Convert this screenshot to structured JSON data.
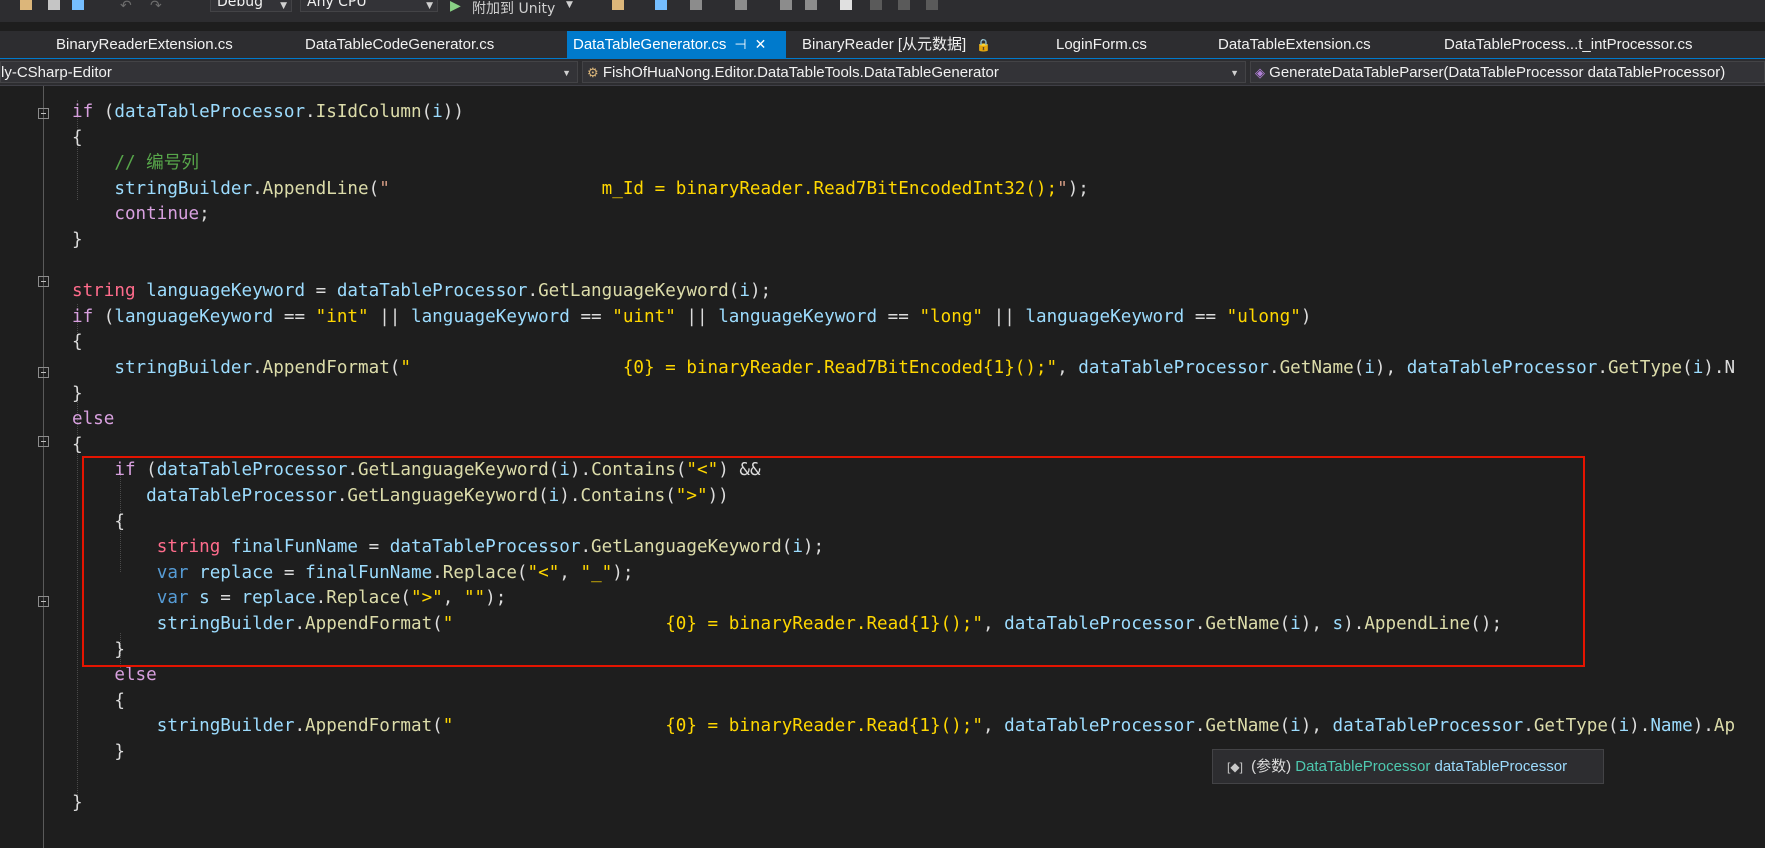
{
  "toolbar": {
    "configuration": "Debug",
    "platform": "Any CPU",
    "attach_label": "附加到 Unity"
  },
  "tabs": [
    {
      "label": "BinaryReaderExtension.cs"
    },
    {
      "label": "DataTableCodeGenerator.cs"
    },
    {
      "label": "DataTableGenerator.cs",
      "active": true
    },
    {
      "label": "BinaryReader [从元数据]"
    },
    {
      "label": "LoginForm.cs"
    },
    {
      "label": "DataTableExtension.cs"
    },
    {
      "label": "DataTableProcess...t_intProcessor.cs"
    }
  ],
  "navbar": {
    "project": "ly-CSharp-Editor",
    "class": "FishOfHuaNong.Editor.DataTableTools.DataTableGenerator",
    "member": "GenerateDataTableParser(DataTableProcessor dataTableProcessor)"
  },
  "code_lines": [
    {
      "tokens": [
        [
          "k-ctl",
          "if"
        ],
        [
          "k-op",
          " ("
        ],
        [
          "k-id",
          "dataTableProcessor"
        ],
        [
          "k-op",
          "."
        ],
        [
          "k-fn",
          "IsIdColumn"
        ],
        [
          "k-op",
          "("
        ],
        [
          "k-id",
          "i"
        ],
        [
          "k-op",
          "))"
        ]
      ]
    },
    {
      "tokens": [
        [
          "k-op",
          "{"
        ]
      ]
    },
    {
      "tokens": [
        [
          "k-cm",
          "    // 编号列"
        ]
      ]
    },
    {
      "tokens": [
        [
          "k-id",
          "    stringBuilder"
        ],
        [
          "k-op",
          "."
        ],
        [
          "k-fn",
          "AppendLine"
        ],
        [
          "k-op",
          "("
        ],
        [
          "k-str",
          "\""
        ],
        [
          "k-str2",
          "                    m_Id = binaryReader.Read7BitEncodedInt32();"
        ],
        [
          "k-str",
          "\""
        ],
        [
          "k-op",
          ");"
        ]
      ]
    },
    {
      "tokens": [
        [
          "k-ctl",
          "    continue"
        ],
        [
          "k-op",
          ";"
        ]
      ]
    },
    {
      "tokens": [
        [
          "k-op",
          "}"
        ]
      ]
    },
    {
      "tokens": [
        [
          "k-op",
          ""
        ]
      ]
    },
    {
      "tokens": [
        [
          "k-type",
          "string"
        ],
        [
          "k-op",
          " "
        ],
        [
          "k-id",
          "languageKeyword"
        ],
        [
          "k-op",
          " = "
        ],
        [
          "k-id",
          "dataTableProcessor"
        ],
        [
          "k-op",
          "."
        ],
        [
          "k-fn",
          "GetLanguageKeyword"
        ],
        [
          "k-op",
          "("
        ],
        [
          "k-id",
          "i"
        ],
        [
          "k-op",
          ");"
        ]
      ]
    },
    {
      "tokens": [
        [
          "k-ctl",
          "if"
        ],
        [
          "k-op",
          " ("
        ],
        [
          "k-id",
          "languageKeyword"
        ],
        [
          "k-op",
          " == "
        ],
        [
          "k-str2",
          "\"int\""
        ],
        [
          "k-op",
          " || "
        ],
        [
          "k-id",
          "languageKeyword"
        ],
        [
          "k-op",
          " == "
        ],
        [
          "k-str2",
          "\"uint\""
        ],
        [
          "k-op",
          " || "
        ],
        [
          "k-id",
          "languageKeyword"
        ],
        [
          "k-op",
          " == "
        ],
        [
          "k-str2",
          "\"long\""
        ],
        [
          "k-op",
          " || "
        ],
        [
          "k-id",
          "languageKeyword"
        ],
        [
          "k-op",
          " == "
        ],
        [
          "k-str2",
          "\"ulong\""
        ],
        [
          "k-op",
          ")"
        ]
      ]
    },
    {
      "tokens": [
        [
          "k-op",
          "{"
        ]
      ]
    },
    {
      "tokens": [
        [
          "k-id",
          "    stringBuilder"
        ],
        [
          "k-op",
          "."
        ],
        [
          "k-fn",
          "AppendFormat"
        ],
        [
          "k-op",
          "("
        ],
        [
          "k-str2",
          "\"                    {0} = binaryReader.Read7BitEncoded{1}();\""
        ],
        [
          "k-op",
          ", "
        ],
        [
          "k-id",
          "dataTableProcessor"
        ],
        [
          "k-op",
          "."
        ],
        [
          "k-fn",
          "GetName"
        ],
        [
          "k-op",
          "("
        ],
        [
          "k-id",
          "i"
        ],
        [
          "k-op",
          "), "
        ],
        [
          "k-id",
          "dataTableProcessor"
        ],
        [
          "k-op",
          "."
        ],
        [
          "k-fn",
          "GetType"
        ],
        [
          "k-op",
          "("
        ],
        [
          "k-id",
          "i"
        ],
        [
          "k-op",
          ").N"
        ]
      ]
    },
    {
      "tokens": [
        [
          "k-op",
          "}"
        ]
      ]
    },
    {
      "tokens": [
        [
          "k-ctl",
          "else"
        ]
      ]
    },
    {
      "tokens": [
        [
          "k-op",
          "{"
        ]
      ]
    },
    {
      "tokens": [
        [
          "k-ctl",
          "    if"
        ],
        [
          "k-op",
          " ("
        ],
        [
          "k-id",
          "dataTableProcessor"
        ],
        [
          "k-op",
          "."
        ],
        [
          "k-fn",
          "GetLanguageKeyword"
        ],
        [
          "k-op",
          "("
        ],
        [
          "k-id",
          "i"
        ],
        [
          "k-op",
          ")."
        ],
        [
          "k-fn",
          "Contains"
        ],
        [
          "k-op",
          "("
        ],
        [
          "k-str2",
          "\"<\""
        ],
        [
          "k-op",
          ") &&"
        ]
      ]
    },
    {
      "tokens": [
        [
          "k-id",
          "       dataTableProcessor"
        ],
        [
          "k-op",
          "."
        ],
        [
          "k-fn",
          "GetLanguageKeyword"
        ],
        [
          "k-op",
          "("
        ],
        [
          "k-id",
          "i"
        ],
        [
          "k-op",
          ")."
        ],
        [
          "k-fn",
          "Contains"
        ],
        [
          "k-op",
          "("
        ],
        [
          "k-str2",
          "\">\""
        ],
        [
          "k-op",
          "))"
        ]
      ]
    },
    {
      "tokens": [
        [
          "k-op",
          "    {"
        ]
      ]
    },
    {
      "tokens": [
        [
          "k-type",
          "        string"
        ],
        [
          "k-op",
          " "
        ],
        [
          "k-id",
          "finalFunName"
        ],
        [
          "k-op",
          " = "
        ],
        [
          "k-id",
          "dataTableProcessor"
        ],
        [
          "k-op",
          "."
        ],
        [
          "k-fn",
          "GetLanguageKeyword"
        ],
        [
          "k-op",
          "("
        ],
        [
          "k-id",
          "i"
        ],
        [
          "k-op",
          ");"
        ]
      ]
    },
    {
      "tokens": [
        [
          "k-kw",
          "        var"
        ],
        [
          "k-op",
          " "
        ],
        [
          "k-id",
          "replace"
        ],
        [
          "k-op",
          " = "
        ],
        [
          "k-id",
          "finalFunName"
        ],
        [
          "k-op",
          "."
        ],
        [
          "k-fn",
          "Replace"
        ],
        [
          "k-op",
          "("
        ],
        [
          "k-str2",
          "\"<\""
        ],
        [
          "k-op",
          ", "
        ],
        [
          "k-str2",
          "\"_\""
        ],
        [
          "k-op",
          ");"
        ]
      ]
    },
    {
      "tokens": [
        [
          "k-kw",
          "        var"
        ],
        [
          "k-op",
          " "
        ],
        [
          "k-id",
          "s"
        ],
        [
          "k-op",
          " = "
        ],
        [
          "k-id",
          "replace"
        ],
        [
          "k-op",
          "."
        ],
        [
          "k-fn",
          "Replace"
        ],
        [
          "k-op",
          "("
        ],
        [
          "k-str2",
          "\">\""
        ],
        [
          "k-op",
          ", "
        ],
        [
          "k-str2",
          "\"\""
        ],
        [
          "k-op",
          ");"
        ]
      ]
    },
    {
      "tokens": [
        [
          "k-id",
          "        stringBuilder"
        ],
        [
          "k-op",
          "."
        ],
        [
          "k-fn",
          "AppendFormat"
        ],
        [
          "k-op",
          "("
        ],
        [
          "k-str2",
          "\"                    {0} = binaryReader.Read{1}();\""
        ],
        [
          "k-op",
          ", "
        ],
        [
          "k-id",
          "dataTableProcessor"
        ],
        [
          "k-op",
          "."
        ],
        [
          "k-fn",
          "GetName"
        ],
        [
          "k-op",
          "("
        ],
        [
          "k-id",
          "i"
        ],
        [
          "k-op",
          "), "
        ],
        [
          "k-id",
          "s"
        ],
        [
          "k-op",
          ")."
        ],
        [
          "k-fn",
          "AppendLine"
        ],
        [
          "k-op",
          "();"
        ]
      ]
    },
    {
      "tokens": [
        [
          "k-op",
          "    }"
        ]
      ]
    },
    {
      "tokens": [
        [
          "k-ctl",
          "    else"
        ]
      ]
    },
    {
      "tokens": [
        [
          "k-op",
          "    {"
        ]
      ]
    },
    {
      "tokens": [
        [
          "k-id",
          "        stringBuilder"
        ],
        [
          "k-op",
          "."
        ],
        [
          "k-fn",
          "AppendFormat"
        ],
        [
          "k-op",
          "("
        ],
        [
          "k-str2",
          "\"                    {0} = binaryReader.Read{1}();\""
        ],
        [
          "k-op",
          ", "
        ],
        [
          "k-id",
          "dataTableProcessor"
        ],
        [
          "k-op",
          "."
        ],
        [
          "k-fn",
          "GetName"
        ],
        [
          "k-op",
          "("
        ],
        [
          "k-id",
          "i"
        ],
        [
          "k-op",
          "), "
        ],
        [
          "k-id",
          "dataTableProcessor"
        ],
        [
          "k-op",
          "."
        ],
        [
          "k-fn",
          "GetType"
        ],
        [
          "k-op",
          "("
        ],
        [
          "k-id",
          "i"
        ],
        [
          "k-op",
          ")."
        ],
        [
          "k-id",
          "Name"
        ],
        [
          "k-op",
          ")."
        ],
        [
          "k-fn",
          "Ap"
        ]
      ]
    },
    {
      "tokens": [
        [
          "k-op",
          "    }"
        ]
      ]
    },
    {
      "tokens": [
        [
          "k-op",
          ""
        ]
      ]
    },
    {
      "tokens": [
        [
          "k-op",
          "}"
        ]
      ]
    }
  ],
  "tooltip": {
    "icon": "[◆]",
    "prefix": "(参数)",
    "type": "DataTableProcessor",
    "name": "dataTableProcessor"
  }
}
